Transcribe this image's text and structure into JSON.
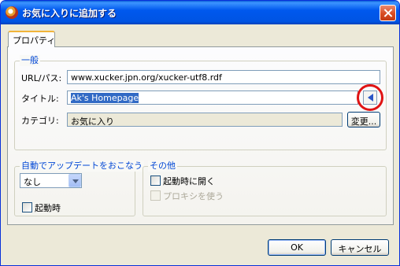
{
  "window": {
    "title": "お気に入りに追加する"
  },
  "tabs": [
    {
      "label": "プロパティ"
    }
  ],
  "general": {
    "title": "一般",
    "url_label": "URL/パス:",
    "url_value": "www.xucker.jpn.org/xucker-utf8.rdf",
    "title_label": "タイトル:",
    "title_value": "Ak's Homepage",
    "category_label": "カテゴリ:",
    "category_value": "お気に入り",
    "change_button": "変更..."
  },
  "auto_update": {
    "title": "自動でアップデートをおこなう",
    "select_value": "なし",
    "startup_checkbox": {
      "label": "起動時",
      "checked": false
    }
  },
  "other": {
    "title": "その他",
    "open_on_startup": {
      "label": "起動時に開く",
      "checked": false
    },
    "use_proxy": {
      "label": "プロキシを使う",
      "checked": false,
      "enabled": false
    }
  },
  "footer": {
    "ok_label": "OK",
    "cancel_label": "キャンセル"
  },
  "colors": {
    "titlebar": "#0054e3",
    "highlight_ring": "#e01414",
    "group_title": "#0046d5"
  }
}
